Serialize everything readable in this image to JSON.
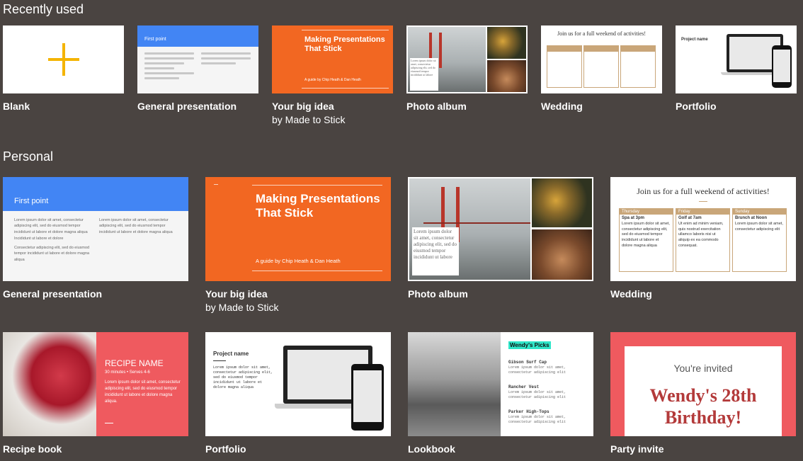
{
  "sections": {
    "recent": "Recently used",
    "personal": "Personal"
  },
  "recent": [
    {
      "label": "Blank"
    },
    {
      "label": "General presentation",
      "thumb_title": "First point"
    },
    {
      "label": "Your big idea",
      "sublabel": "by Made to Stick",
      "thumb_title": "Making Presentations That Stick",
      "thumb_sub": "A guide by Chip Heath & Dan Heath"
    },
    {
      "label": "Photo album",
      "thumb_caption": "Lorem ipsum dolor sit amet, consectetur adipiscing elit, sed do eiusmod tempor incididunt ut labore"
    },
    {
      "label": "Wedding",
      "thumb_title": "Join us for a full weekend of activities!"
    },
    {
      "label": "Portfolio",
      "thumb_title": "Project name"
    }
  ],
  "personal": [
    {
      "label": "General presentation",
      "thumb_title": "First point",
      "col1_a": "Lorem ipsum dolor sit amet, consectetur adipiscing elit, sed do eiusmod tempor incididunt ut labore et dolore magna aliqua",
      "col1_b": "Incididunt ut labore et dolore",
      "col1_c": "Consectetur adipiscing elit, sed do eiusmod tempor incididunt ut labore et dolore magna aliqua",
      "col2": "Lorem ipsum dolor sit amet, consectetur adipiscing elit, sed do eiusmod tempor incididunt ut labore et dolore magna aliqua"
    },
    {
      "label": "Your big idea",
      "sublabel": "by Made to Stick",
      "thumb_title": "Making Presentations That Stick",
      "thumb_sub": "A guide by Chip Heath & Dan Heath"
    },
    {
      "label": "Photo album",
      "thumb_caption": "Lorem ipsum dolor sit amet, consectetur adipiscing elit, sed do eiusmod tempor incididunt ut labore"
    },
    {
      "label": "Wedding",
      "thumb_title": "Join us for a full weekend of activities!",
      "days": [
        {
          "day": "Thursday",
          "event": "Spa at 3pm",
          "text": "Lorem ipsum dolor sit amet, consectetur adipiscing elit, sed do eiusmod tempor incididunt ut labore et dolore magna aliqua"
        },
        {
          "day": "Friday",
          "event": "Golf at 7am",
          "text": "Ut enim ad minim veniam, quis nostrud exercitation ullamco laboris nisi ut aliquip ex ea commodo consequat."
        },
        {
          "day": "Sunday",
          "event": "Brunch at Noon",
          "text": "Lorem ipsum dolor sit amet, consectetur adipiscing elit"
        }
      ]
    },
    {
      "label": "Recipe book",
      "thumb_title": "RECIPE NAME",
      "thumb_meta": "30 minutes • Serves 4-6",
      "thumb_text": "Lorem ipsum dolor sit amet, consectetur adipiscing elit, sed do eiusmod tempor incididunt ut labore et dolore magna aliqua."
    },
    {
      "label": "Portfolio",
      "thumb_title": "Project name",
      "thumb_text": "Lorem ipsum dolor sit amet, consectetur adipiscing elit, sed do eiusmod tempor incididunt ut labore et dolore magna aliqua"
    },
    {
      "label": "Lookbook",
      "thumb_title": "Wendy's Picks",
      "items": [
        {
          "name": "Gibson Surf Cap",
          "text": "Lorem ipsum dolor sit amet, consectetur adipiscing elit"
        },
        {
          "name": "Rancher Vest",
          "text": "Lorem ipsum dolor sit amet, consectetur adipiscing elit"
        },
        {
          "name": "Parker High-Tops",
          "text": "Lorem ipsum dolor sit amet, consectetur adipiscing elit"
        }
      ]
    },
    {
      "label": "Party invite",
      "thumb_sub": "You're invited",
      "thumb_title": "Wendy's 28th Birthday!"
    }
  ],
  "colors": {
    "background": "#4a4441",
    "blue": "#4285f4",
    "orange": "#f26722",
    "coral": "#ef5a5f",
    "plus_yellow": "#f4b400",
    "wedding_tan": "#c9a679",
    "birthday_red": "#b33a3a",
    "lookbook_highlight": "#2fe6c9"
  },
  "icons": {
    "blank_plus": "plus-icon"
  }
}
